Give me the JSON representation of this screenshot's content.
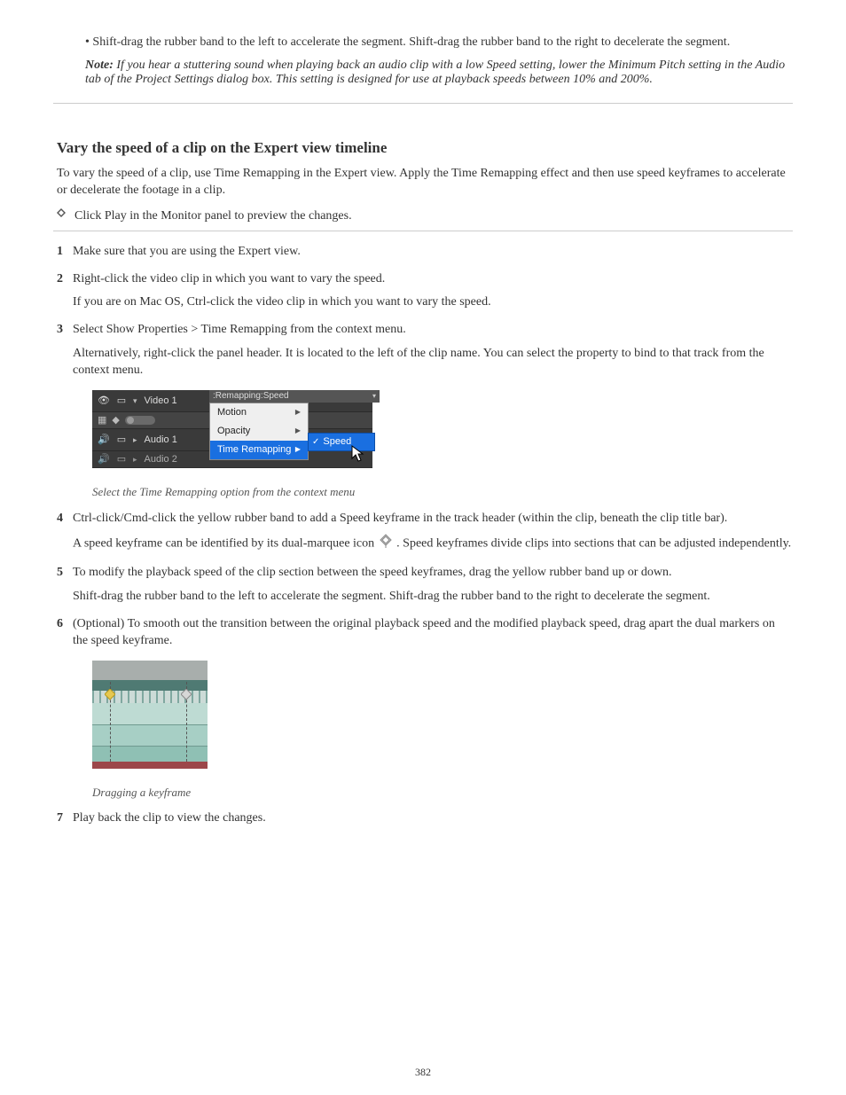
{
  "top_bullet": "Shift-drag the rubber band to the left to accelerate the segment. Shift-drag the rubber band to the right to decelerate the segment.",
  "top_note": "If you hear a stuttering sound when playing back an audio clip with a low Speed setting, lower the Minimum Pitch setting in the Audio tab of the Project Settings dialog box. This setting is designed for use at playback speeds between 10% and 200%.",
  "note_label": "Note:",
  "heading": "Vary the speed of a clip on the Expert view timeline",
  "intro": "To vary the speed of a clip, use Time Remapping in the Expert view. Apply the Time Remapping effect and then use speed keyframes to accelerate or decelerate the footage in a clip.",
  "steps": {
    "s1": "Make sure that you are using the Expert view.",
    "s2a": "Right-click the video clip in which you want to vary the speed.",
    "s2b": "If you are on Mac OS, Ctrl-click the video clip in which you want to vary the speed.",
    "s3a": "Select Show Properties > Time Remapping from the context menu.",
    "s3b": "Alternatively, right-click the panel header. It is located to the left of the clip name. You can select the property to bind to that track from the context menu.",
    "s4a": "Ctrl-click/Cmd-click the yellow rubber band to add a Speed keyframe       in the track header (within the clip, beneath the clip title bar).",
    "s4b": "A speed keyframe can be identified by its dual-marquee icon     . Speed keyframes divide clips into sections that can be adjusted independently.",
    "s5a": "To modify the playback speed of the clip section between the speed keyframes, drag the yellow rubber band up or down.",
    "s5b": "Shift-drag the rubber band to the left to accelerate the segment. Shift-drag the rubber band to the right to decelerate the segment.",
    "s6": "(Optional) To smooth out the transition between the original playback speed and the modified playback speed, drag apart the dual markers on the speed keyframe.",
    "s7": "Play back the clip to view the changes."
  },
  "fig1_caption": "Select the Time Remapping option from the context menu",
  "fig1": {
    "clip_header": ":Remapping:Speed",
    "video1": "Video 1",
    "audio1": "Audio 1",
    "audio2": "Audio 2",
    "menu": {
      "motion": "Motion",
      "opacity": "Opacity",
      "time_remapping": "Time Remapping",
      "speed": "Speed"
    }
  },
  "dragging_caption": "Dragging a keyframe",
  "ramp_bullet": "Click Play in the Monitor panel to preview the changes.",
  "page_number": "382"
}
